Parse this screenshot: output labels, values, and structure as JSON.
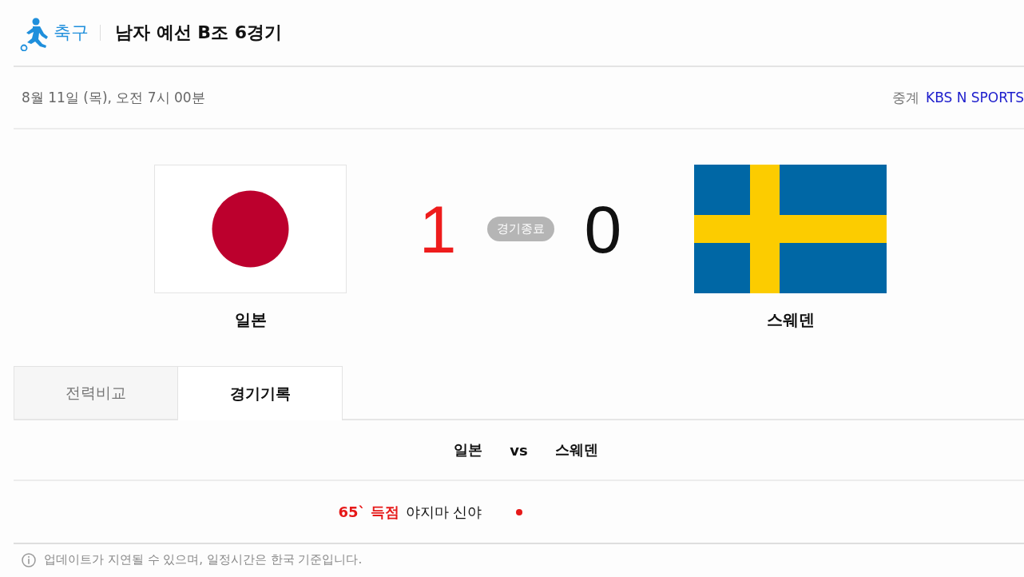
{
  "header": {
    "sport": "축구",
    "title": "남자 예선 B조 6경기"
  },
  "info": {
    "datetime": "8월 11일 (목), 오전 7시 00분",
    "broadcast_label": "중계",
    "broadcaster": "KBS N SPORTS"
  },
  "match": {
    "teams": [
      {
        "kind": "japan",
        "name": "일본",
        "score": "1",
        "winner": true
      },
      {
        "kind": "sweden",
        "name": "스웨덴",
        "score": "0",
        "winner": false
      }
    ],
    "status": "경기종료"
  },
  "tabs": [
    {
      "label": "전력비교",
      "selected": false
    },
    {
      "label": "경기기록",
      "selected": true
    }
  ],
  "record": {
    "home": "일본",
    "vs": "vs",
    "away": "스웨덴",
    "events": [
      {
        "event": "65` 득점",
        "player": "야지마 신야"
      }
    ]
  },
  "notice": "업데이트가 지연될 수 있으며, 일정시간은 한국 기준입니다."
}
